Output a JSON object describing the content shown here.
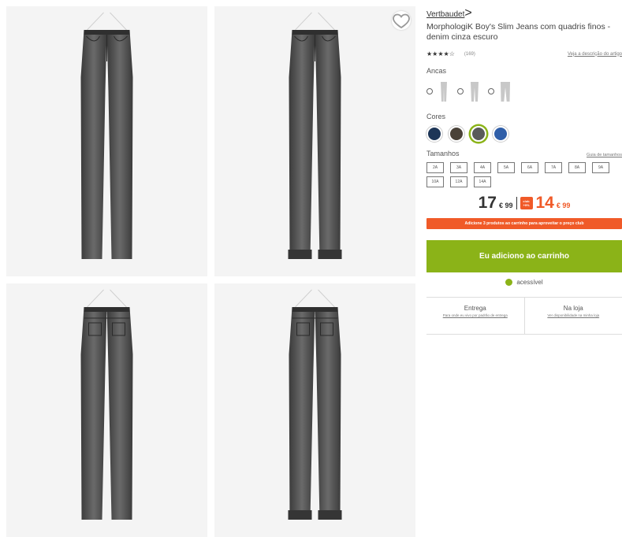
{
  "gallery": {
    "photos": [
      {
        "view": "front",
        "cuffed": false
      },
      {
        "view": "front",
        "cuffed": true
      },
      {
        "view": "back",
        "cuffed": false
      },
      {
        "view": "back",
        "cuffed": true
      }
    ],
    "wishlist_icon": "heart-outline-icon"
  },
  "product": {
    "brand": "Vertbaudet",
    "brand_chevron": ">",
    "title": "MorphologiK Boy's Slim Jeans com quadris finos - denim cinza escuro",
    "stars": "★★★★☆",
    "rating_count": "(169)",
    "see_link": "Veja a descrição do artigo"
  },
  "cuts": {
    "label": "Ancas",
    "options": [
      {
        "name": "fino"
      },
      {
        "name": "médio"
      },
      {
        "name": "largo"
      }
    ]
  },
  "colors": {
    "label": "Cores",
    "swatches": [
      {
        "name": "navy",
        "hex": "#1d3557",
        "selected": false
      },
      {
        "name": "brown",
        "hex": "#4a4238",
        "selected": false
      },
      {
        "name": "grey",
        "hex": "#5a5a5a",
        "selected": true
      },
      {
        "name": "blue",
        "hex": "#2f5ea8",
        "selected": false
      }
    ]
  },
  "sizes": {
    "label": "Tamanhos",
    "guide": "Guia de tamanhos",
    "items": [
      "2A",
      "3A",
      "4A",
      "5A",
      "6A",
      "7A",
      "8A",
      "9A",
      "10A",
      "12A",
      "14A"
    ]
  },
  "price": {
    "old_main": "17",
    "old_cents": "€ 99",
    "badge_line1": "club",
    "badge_line2": "+9%",
    "new_main": "14",
    "new_cents": "€ 99"
  },
  "promo": {
    "text": "Adicione 3 produtos ao carrinho para aproveitar o preço club"
  },
  "cart": {
    "button": "Eu adiciono ao carrinho"
  },
  "availability": {
    "text": "acessível",
    "color": "#8bb318"
  },
  "delivery": {
    "options": [
      {
        "title": "Entrega",
        "sub": "Para onde eu vivo por padrão de entrega"
      },
      {
        "title": "Na loja",
        "sub": "Ver disponibilidade na minha loja"
      }
    ]
  },
  "colors_theme": {
    "accent_green": "#8bb318",
    "accent_orange": "#f05a28"
  }
}
